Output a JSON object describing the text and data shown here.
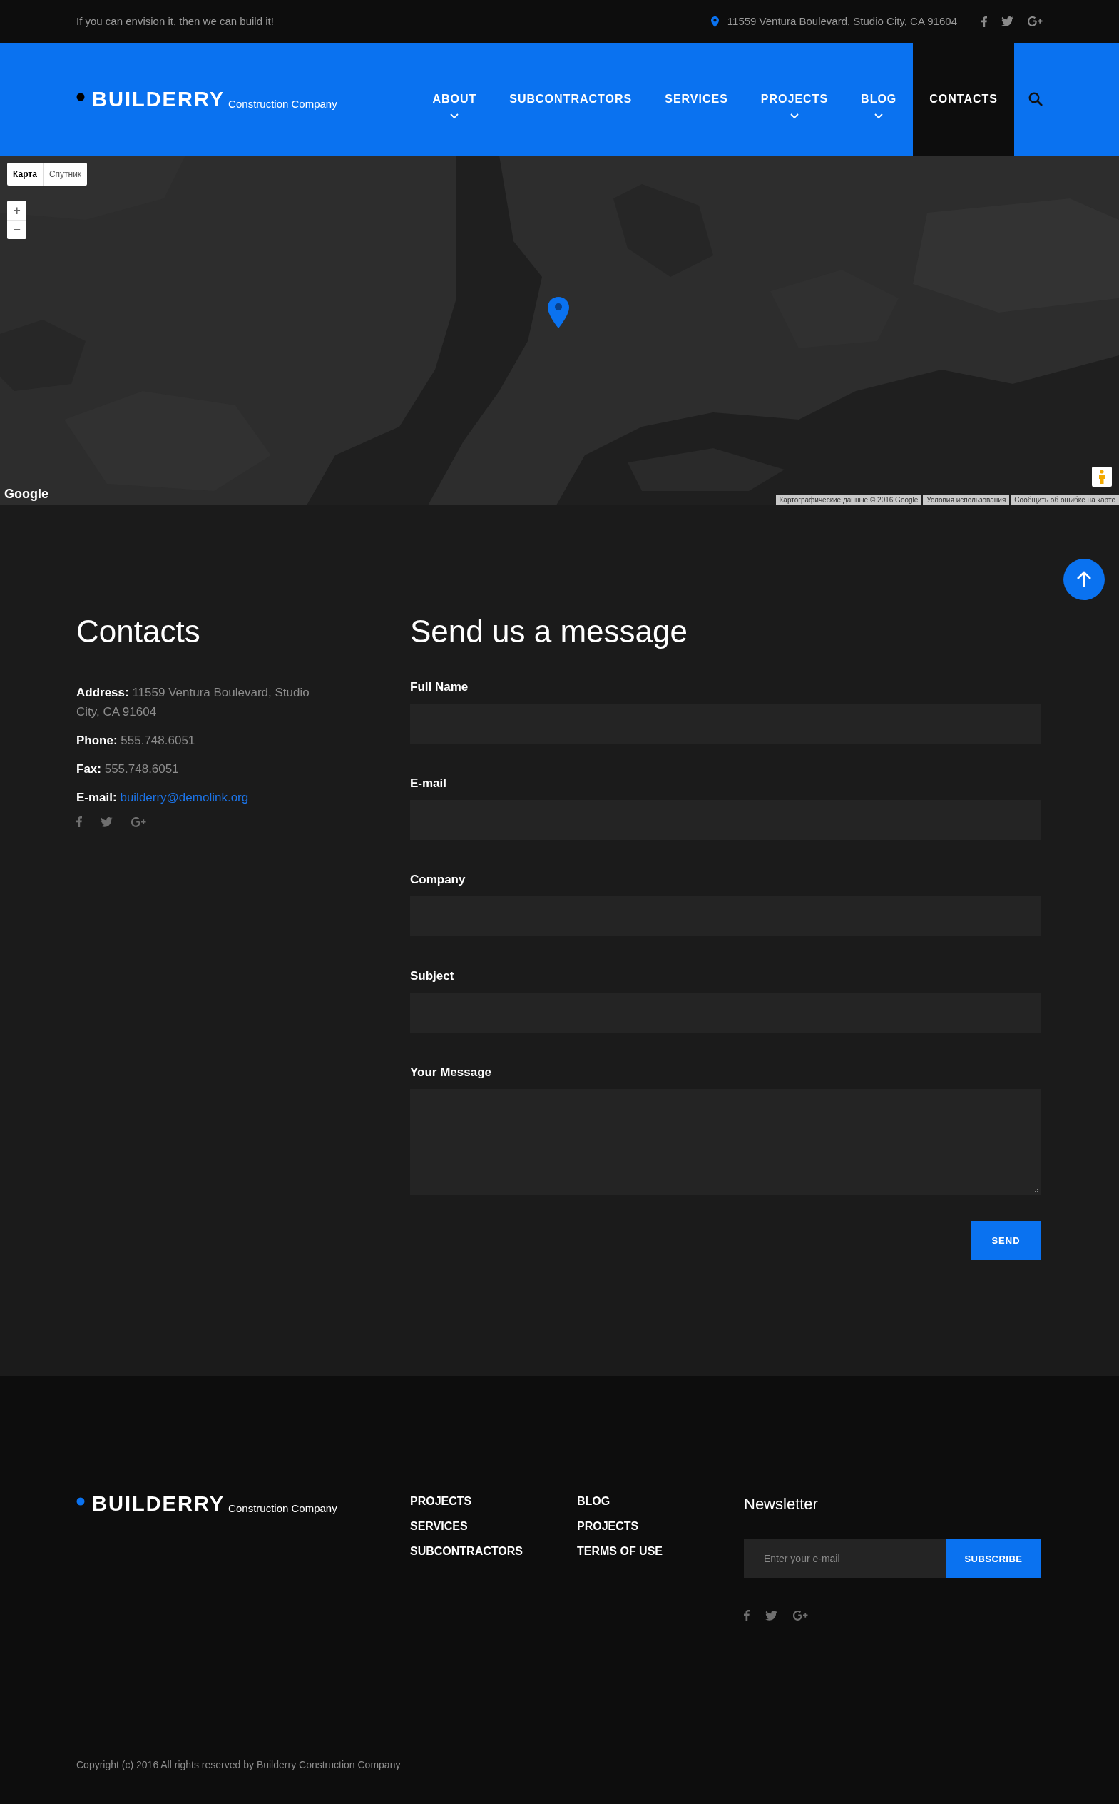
{
  "top_bar": {
    "tagline": "If you can envision it, then we can build it!",
    "address": "11559 Ventura Boulevard, Studio City, CA 91604"
  },
  "header": {
    "logo": {
      "name": "BUILDERRY",
      "subtitle": "Construction Company"
    },
    "nav": [
      {
        "label": "ABOUT",
        "dropdown": true,
        "selected": false
      },
      {
        "label": "SUBCONTRACTORS",
        "dropdown": false,
        "selected": false
      },
      {
        "label": "SERVICES",
        "dropdown": false,
        "selected": false
      },
      {
        "label": "PROJECTS",
        "dropdown": true,
        "selected": false
      },
      {
        "label": "BLOG",
        "dropdown": true,
        "selected": false
      },
      {
        "label": "CONTACTS",
        "dropdown": false,
        "selected": true
      }
    ]
  },
  "map": {
    "kind": "picture",
    "map_types": [
      {
        "label": "Карта",
        "selected": true
      },
      {
        "label": "Спутник",
        "selected": false
      }
    ],
    "zoom": [
      "+",
      "−"
    ],
    "brand": "Google",
    "attribution": [
      "Картографические данные © 2016 Google",
      "Условия использования",
      "Сообщить об ошибке на карте"
    ]
  },
  "contacts": {
    "title": "Contacts",
    "items": [
      {
        "text": "**Address:** 11559 Ventura Boulevard, Studio City, CA 91604",
        "kind": "text"
      },
      {
        "text": "**Phone:** 555.748.6051",
        "kind": "text"
      },
      {
        "text": "**Fax:** 555.748.6051",
        "kind": "text"
      },
      {
        "label": "E-mail:",
        "value": "builderry@demolink.org",
        "kind": "link"
      }
    ]
  },
  "form": {
    "title": "Send us a message",
    "fields": [
      {
        "label": "Full Name",
        "kind": "input"
      },
      {
        "label": "E-mail",
        "kind": "input"
      },
      {
        "label": "Company",
        "kind": "input"
      },
      {
        "label": "Subject",
        "kind": "input"
      },
      {
        "label": "Your Message",
        "kind": "textarea"
      }
    ],
    "button": "SEND"
  },
  "footer": {
    "logo": {
      "name": "BUILDERRY",
      "subtitle": "Construction Company"
    },
    "link_columns": [
      [
        "PROJECTS",
        "SERVICES",
        "SUBCONTRACTORS"
      ],
      [
        "BLOG",
        "PROJECTS",
        "TERMS OF USE"
      ]
    ],
    "newsletter": {
      "title": "Newsletter",
      "placeholder": "Enter your e-mail",
      "button": "SUBSCRIBE"
    }
  },
  "copyright": "Copyright (c) 2016 All rights reserved by Builderry Construction Company"
}
